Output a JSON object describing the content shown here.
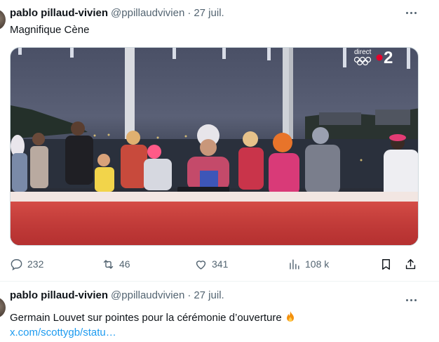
{
  "tweets": [
    {
      "author_name": "pablo pillaud-vivien",
      "handle": "@ppillaudvivien",
      "separator": "·",
      "date": "27 juil.",
      "text": "Magnifique Cène",
      "media": {
        "overlay_label": "direct",
        "channel_number": "2"
      },
      "stats": {
        "replies": "232",
        "retweets": "46",
        "likes": "341",
        "views": "108 k"
      }
    },
    {
      "author_name": "pablo pillaud-vivien",
      "handle": "@ppillaudvivien",
      "separator": "·",
      "date": "27 juil.",
      "text": "Germain Louvet sur pointes pour la cérémonie d’ouverture",
      "link": "x.com/scottygb/statu…"
    }
  ],
  "icons": {
    "more": "more-icon",
    "reply": "reply-icon",
    "retweet": "retweet-icon",
    "like": "heart-icon",
    "views": "views-icon",
    "bookmark": "bookmark-icon",
    "share": "share-icon",
    "emoji": "fire-emoji-icon"
  },
  "colors": {
    "text": "#0f1419",
    "secondary": "#536471",
    "link": "#1d9bf0",
    "border": "#cfd9de"
  }
}
